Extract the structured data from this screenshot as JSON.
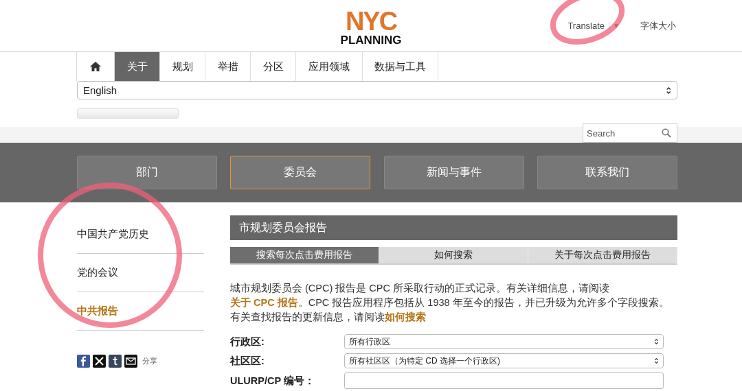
{
  "header": {
    "logo": {
      "top": "NYC",
      "bottom": "PLANNING"
    },
    "translate": "Translate",
    "translate_caret": "▼",
    "font_size": "字体大小"
  },
  "nav_tabs": [
    {
      "kind": "home",
      "selected": false
    },
    {
      "kind": "text",
      "label": "关于",
      "selected": true
    },
    {
      "kind": "text",
      "label": "规划",
      "selected": false
    },
    {
      "kind": "text",
      "label": "举措",
      "selected": false
    },
    {
      "kind": "text",
      "label": "分区",
      "selected": false
    },
    {
      "kind": "text",
      "label": "应用领域",
      "selected": false
    },
    {
      "kind": "text",
      "label": "数据与工具",
      "selected": false
    }
  ],
  "language_select": {
    "value": "English"
  },
  "search": {
    "placeholder": "Search"
  },
  "section_buttons": [
    {
      "label": "部门",
      "selected": false
    },
    {
      "label": "委员会",
      "selected": true
    },
    {
      "label": "新闻与事件",
      "selected": false
    },
    {
      "label": "联系我们",
      "selected": false
    }
  ],
  "sidebar": {
    "items": [
      {
        "label": "中国共产党历史",
        "selected": false
      },
      {
        "label": "党的会议",
        "selected": false
      },
      {
        "label": "中共报告",
        "selected": true
      }
    ],
    "share_icons": [
      {
        "kind": "facebook"
      },
      {
        "kind": "x"
      },
      {
        "kind": "tumblr"
      },
      {
        "kind": "email"
      }
    ],
    "share_label": "分享"
  },
  "main": {
    "title": "市规划委员会报告",
    "tabs": [
      {
        "label": "搜索每次点击费用报告",
        "selected": true
      },
      {
        "label": "如何搜索",
        "selected": false
      },
      {
        "label": "关于每次点击费用报告",
        "selected": false
      }
    ],
    "intro": [
      {
        "text": "城市规划委员会 (CPC) 报告是 CPC 所采取行动的正式记录。有关详细信息，请阅读",
        "link": false
      },
      {
        "text": "关于 CPC 报告",
        "link": true
      },
      {
        "text": "。CPC 报告应用程序包括从 1938 年至今的报告，并已升级为允许多个字段搜索。有关查找报告的更新信息，请阅读",
        "link": false
      },
      {
        "text": "如何搜索",
        "link": true
      }
    ],
    "fields": [
      {
        "kind": "select",
        "label": "行政区:",
        "value": "所有行政区"
      },
      {
        "kind": "select",
        "label": "社区区:",
        "value": "所有社区区（为特定 CD 选择一个行政区)"
      },
      {
        "kind": "text",
        "label": "ULURP/CP 编号："
      }
    ]
  }
}
